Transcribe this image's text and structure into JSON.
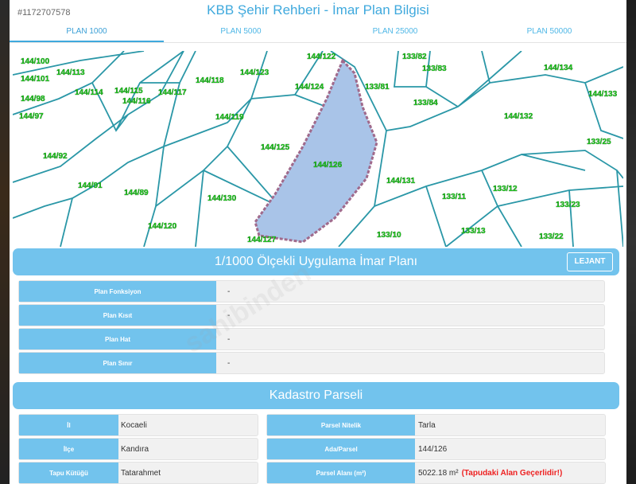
{
  "listing_id": "#1172707578",
  "title": "KBB Şehir Rehberi - İmar Plan Bilgisi",
  "tabs": [
    "PLAN 1000",
    "PLAN 5000",
    "PLAN 25000",
    "PLAN 50000"
  ],
  "map": {
    "parcel_labels": [
      "144/122",
      "133/82",
      "133/83",
      "144/134",
      "144/100",
      "144/113",
      "144/101",
      "144/114",
      "144/115",
      "144/116",
      "144/117",
      "144/118",
      "144/123",
      "144/124",
      "133/81",
      "144/133",
      "144/98",
      "133/84",
      "144/97",
      "144/119",
      "144/132",
      "144/125",
      "133/25",
      "144/92",
      "144/126",
      "144/91",
      "144/131",
      "144/89",
      "144/130",
      "133/11",
      "133/12",
      "133/23",
      "144/120",
      "133/13",
      "133/10",
      "144/127",
      "133/22"
    ],
    "colors": {
      "parcel_lines": "#2a97a7",
      "highlight_fill": "#a9c4e8",
      "highlight_border": "#a06a8c",
      "label": "#1cc51c"
    }
  },
  "imar": {
    "heading": "1/1000 Ölçekli Uygulama İmar Planı",
    "legend_button": "LEJANT",
    "rows": [
      {
        "label": "Plan Fonksiyon",
        "value": "-"
      },
      {
        "label": "Plan Kısıt",
        "value": "-"
      },
      {
        "label": "Plan Hat",
        "value": "-"
      },
      {
        "label": "Plan Sınır",
        "value": "-"
      }
    ]
  },
  "kadastro": {
    "heading": "Kadastro Parseli",
    "left": [
      {
        "label": "İl",
        "value": "Kocaeli"
      },
      {
        "label": "İlçe",
        "value": "Kandıra"
      },
      {
        "label": "Tapu Kütüğü",
        "value": "Tatarahmet"
      }
    ],
    "right": [
      {
        "label": "Parsel Nitelik",
        "value": "Tarla"
      },
      {
        "label": "Ada/Parsel",
        "value": "144/126"
      },
      {
        "label": "Parsel Alanı (m²)",
        "value": "5022.18 m²",
        "note": "(Tapudaki Alan Geçerlidir!)"
      }
    ]
  },
  "watermark": "sahibinden"
}
